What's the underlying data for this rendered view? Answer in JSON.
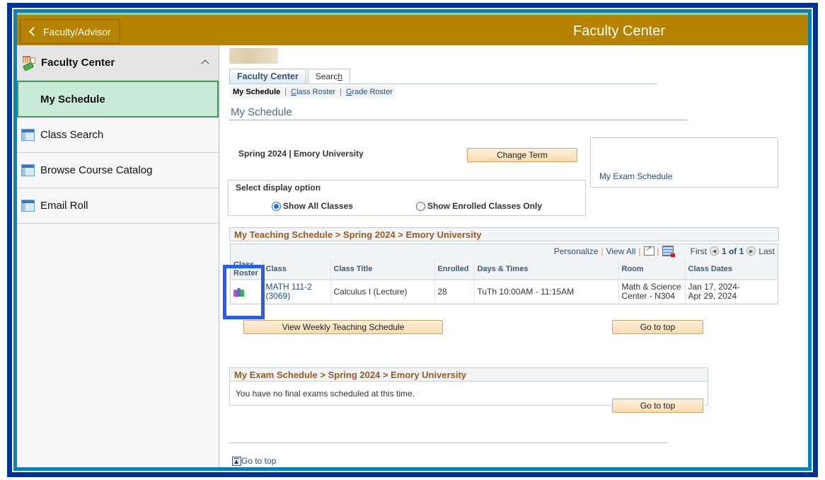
{
  "header": {
    "back_label": "Faculty/Advisor",
    "title": "Faculty Center",
    "color": "#b68300"
  },
  "sidebar": {
    "section": {
      "label": "Faculty Center",
      "icon": "faculty-center-icon",
      "expanded": true
    },
    "active_item": "My Schedule",
    "items": [
      {
        "label": "Class Search",
        "icon": "page-icon"
      },
      {
        "label": "Browse Course Catalog",
        "icon": "page-icon"
      },
      {
        "label": "Email Roll",
        "icon": "page-icon"
      }
    ]
  },
  "tabs": [
    {
      "label": "Faculty Center",
      "active": true
    },
    {
      "label": "Search",
      "accesskey": "h",
      "active": false
    }
  ],
  "subnav": {
    "current": "My Schedule",
    "links": [
      "Class Roster",
      "Grade Roster"
    ],
    "separator": "|"
  },
  "page_title": "My Schedule",
  "term": {
    "text": "Spring 2024 | Emory University",
    "change_button": "Change Term"
  },
  "exam_link": "My Exam Schedule",
  "display_option": {
    "label": "Select display option",
    "options": [
      {
        "label": "Show All Classes",
        "selected": true
      },
      {
        "label": "Show Enrolled Classes Only",
        "selected": false
      }
    ]
  },
  "teaching_schedule": {
    "title": "My Teaching Schedule > Spring 2024 > Emory University",
    "toolbar": {
      "personalize": "Personalize",
      "view_all": "View All",
      "first": "First",
      "page": "1 of 1",
      "last": "Last",
      "sep": "|"
    },
    "columns": [
      "Class Roster",
      "Class",
      "Class Title",
      "Enrolled",
      "Days & Times",
      "Room",
      "Class Dates"
    ],
    "rows": [
      {
        "roster_icon": "class-roster-icon",
        "class_line1": "MATH 111-2",
        "class_line2": "(3069)",
        "title": "Calculus I (Lecture)",
        "enrolled": "28",
        "days_times": "TuTh 10:00AM - 11:15AM",
        "room_line1": "Math & Science",
        "room_line2": "Center - N304",
        "dates_line1": "Jan 17, 2024-",
        "dates_line2": "Apr 29, 2024"
      }
    ],
    "weekly_button": "View Weekly Teaching Schedule",
    "go_top_button": "Go to top"
  },
  "exam_schedule": {
    "title": "My Exam Schedule > Spring 2024 > Emory University",
    "message": "You have no final exams scheduled at this time.",
    "go_top_button": "Go to top"
  },
  "footer_go_top": "Go to top",
  "highlight_color": "#2a5ee8"
}
